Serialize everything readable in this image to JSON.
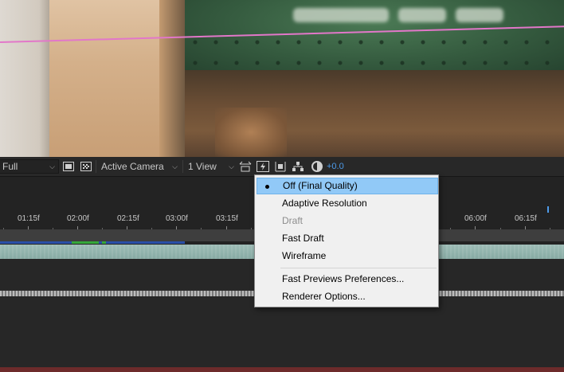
{
  "viewer_toolbar": {
    "resolution": "Full",
    "active_camera": "Active Camera",
    "view_layout": "1 View",
    "exposure": "+0.0"
  },
  "timeline": {
    "ticks": [
      "01:15f",
      "02:00f",
      "02:15f",
      "03:00f",
      "03:15f",
      "06:00f",
      "06:15f"
    ]
  },
  "menu": {
    "items": [
      {
        "label": "Off (Final Quality)",
        "selected": true,
        "enabled": true
      },
      {
        "label": "Adaptive Resolution",
        "selected": false,
        "enabled": true
      },
      {
        "label": "Draft",
        "selected": false,
        "enabled": false
      },
      {
        "label": "Fast Draft",
        "selected": false,
        "enabled": true
      },
      {
        "label": "Wireframe",
        "selected": false,
        "enabled": true
      },
      {
        "label": "Fast Previews Preferences...",
        "selected": false,
        "enabled": true
      },
      {
        "label": "Renderer Options...",
        "selected": false,
        "enabled": true
      }
    ]
  },
  "colors": {
    "accent": "#4d9bea",
    "menu_highlight": "#91c9f7",
    "guide_line": "#e277c9",
    "layer_bar": "#9dbcb6"
  },
  "icons": [
    "chevron-down-icon",
    "region-of-interest-icon",
    "transparency-grid-icon",
    "fast-previews-icon",
    "snapshot-icon",
    "3d-renderer-icon",
    "flowchart-icon",
    "reset-exposure-icon"
  ]
}
